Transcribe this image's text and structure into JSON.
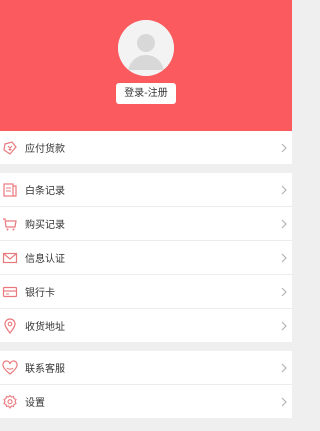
{
  "profile": {
    "login_label": "登录-注册"
  },
  "menu": {
    "payable": {
      "label": "应付货款",
      "icon": "yen-tag-icon"
    },
    "group2": [
      {
        "label": "白条记录",
        "icon": "receipt-icon"
      },
      {
        "label": "购买记录",
        "icon": "cart-icon"
      },
      {
        "label": "信息认证",
        "icon": "envelope-icon"
      },
      {
        "label": "银行卡",
        "icon": "card-icon"
      },
      {
        "label": "收货地址",
        "icon": "location-pin-icon"
      }
    ],
    "group3": [
      {
        "label": "联系客服",
        "icon": "heart-icon"
      },
      {
        "label": "设置",
        "icon": "gear-icon"
      }
    ]
  },
  "colors": {
    "header": "#fb5a5e",
    "icon": "#e9797d"
  }
}
